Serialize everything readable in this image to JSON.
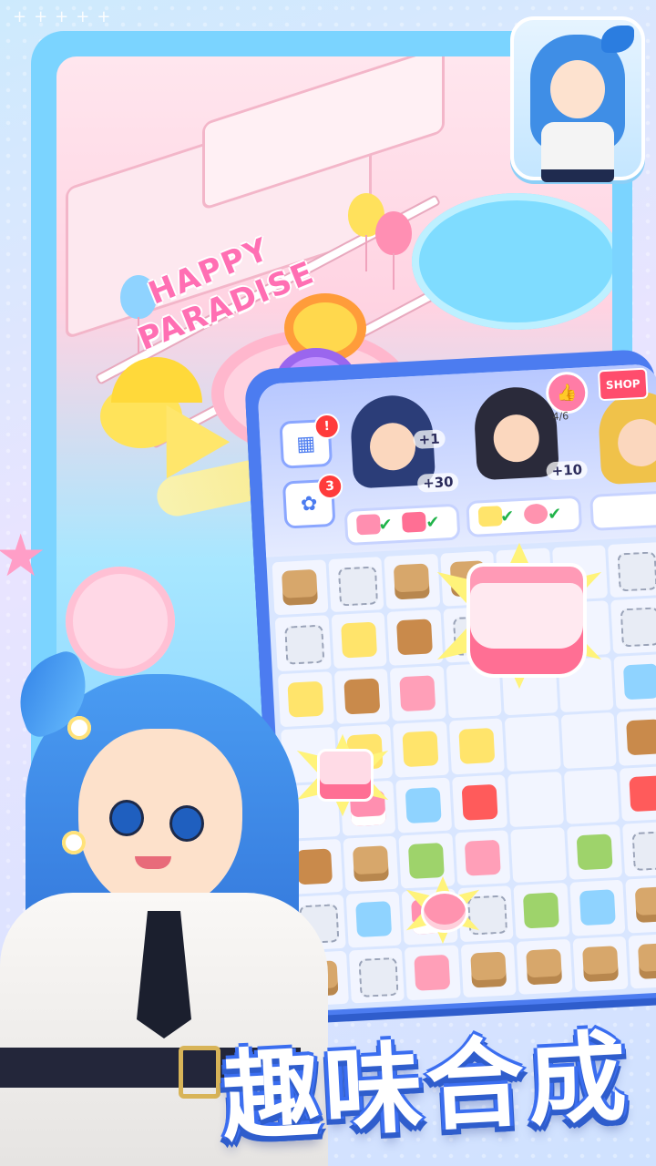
{
  "world": {
    "sign_line1": "HAPPY",
    "sign_line2": "PARADISE"
  },
  "orders": {
    "side_button_top_badge": "!",
    "side_button_bottom_badge": "3",
    "customer1_reward": "+30",
    "customer1_bonus": "+1",
    "customer2_reward": "+10",
    "like_count": "4/6",
    "shop_label": "SHOP"
  },
  "title": {
    "text": "趣味合成"
  },
  "colors": {
    "frame_blue": "#7bd4ff",
    "board_blue": "#4c7cf0",
    "accent_pink": "#ff6fb3",
    "highlight_yellow": "#fff37a"
  },
  "board": {
    "rows": 8,
    "cols": 7,
    "cells": [
      "box",
      "web",
      "box",
      "box",
      "cake-big",
      "",
      "web",
      "web",
      "drink",
      "cookie",
      "web",
      "cake-big",
      "",
      "web",
      "drink",
      "cookie",
      "mac",
      "",
      "",
      "",
      "ice",
      "",
      "drink",
      "drink",
      "drink",
      "",
      "",
      "cookie",
      "",
      "cake",
      "ice",
      "oven",
      "",
      "",
      "oven",
      "cookie",
      "box",
      "tea",
      "mac",
      "",
      "tea",
      "web",
      "web",
      "ice",
      "cake",
      "web",
      "tea",
      "ice",
      "box",
      "box",
      "web",
      "mac",
      "box",
      "box",
      "box",
      "box"
    ]
  }
}
